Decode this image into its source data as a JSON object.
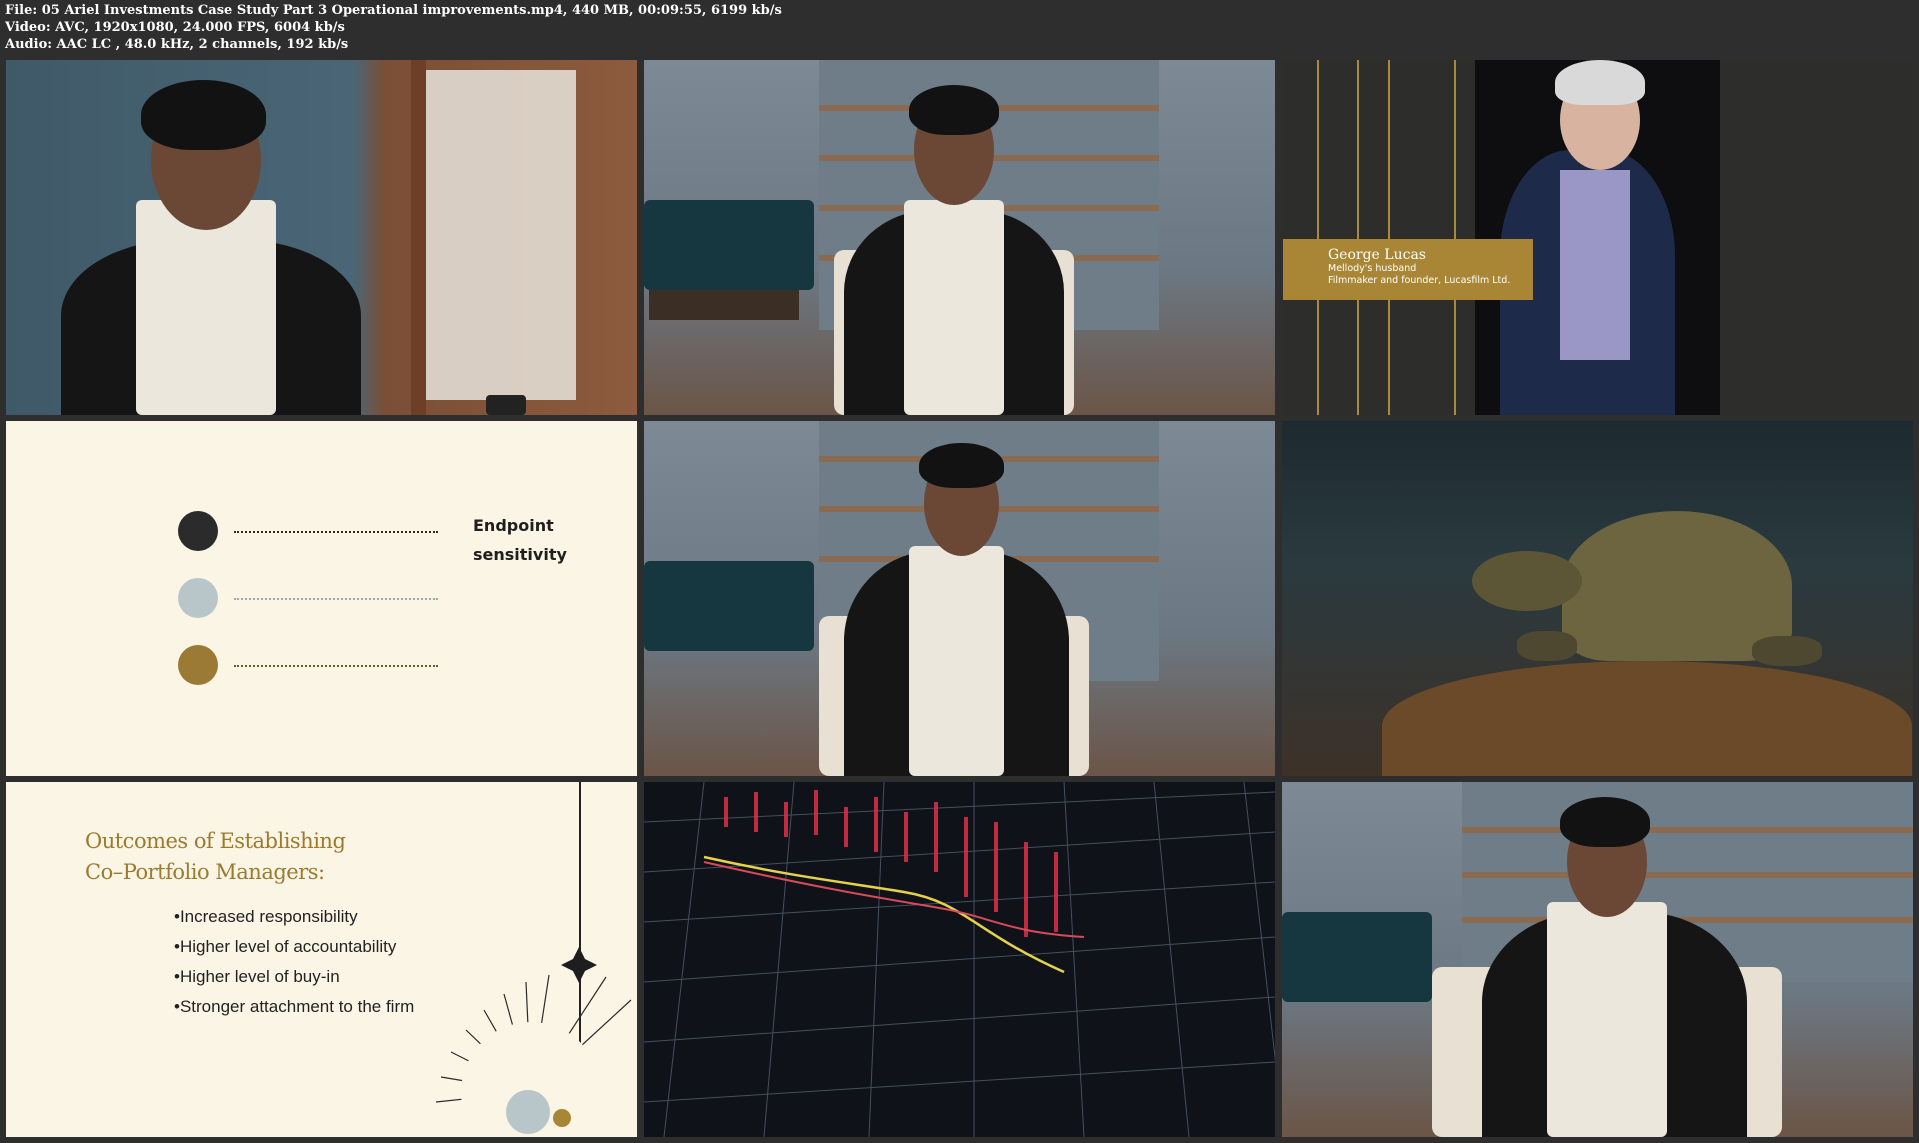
{
  "media_info": {
    "file_line": "File: 05 Ariel Investments Case Study Part 3 Operational improvements.mp4, 440 MB, 00:09:55, 6199 kb/s",
    "video_line": "Video: AVC, 1920x1080, 24.000 FPS, 6004 kb/s",
    "audio_line": "Audio: AAC LC , 48.0 kHz, 2 channels, 192 kb/s"
  },
  "tiles": {
    "lucas": {
      "name": "George Lucas",
      "relation": "Mellody's husband",
      "role": "Filmmaker and founder, Lucasfilm Ltd."
    },
    "endpoint": {
      "label_line1": "Endpoint",
      "label_line2": "sensitivity",
      "dot_colors": [
        "#2b2b2b",
        "#b8c6c9",
        "#9a7a34"
      ]
    },
    "outcomes": {
      "title_line1": "Outcomes of Establishing",
      "title_line2": "Co–Portfolio Managers:",
      "items": [
        "Increased responsibility",
        "Higher level of accountability",
        "Higher level of buy-in",
        "Stronger attachment to the firm"
      ]
    }
  },
  "colors": {
    "background": "#2e2e2e",
    "gold": "#a88636",
    "cream": "#fbf5e6"
  }
}
